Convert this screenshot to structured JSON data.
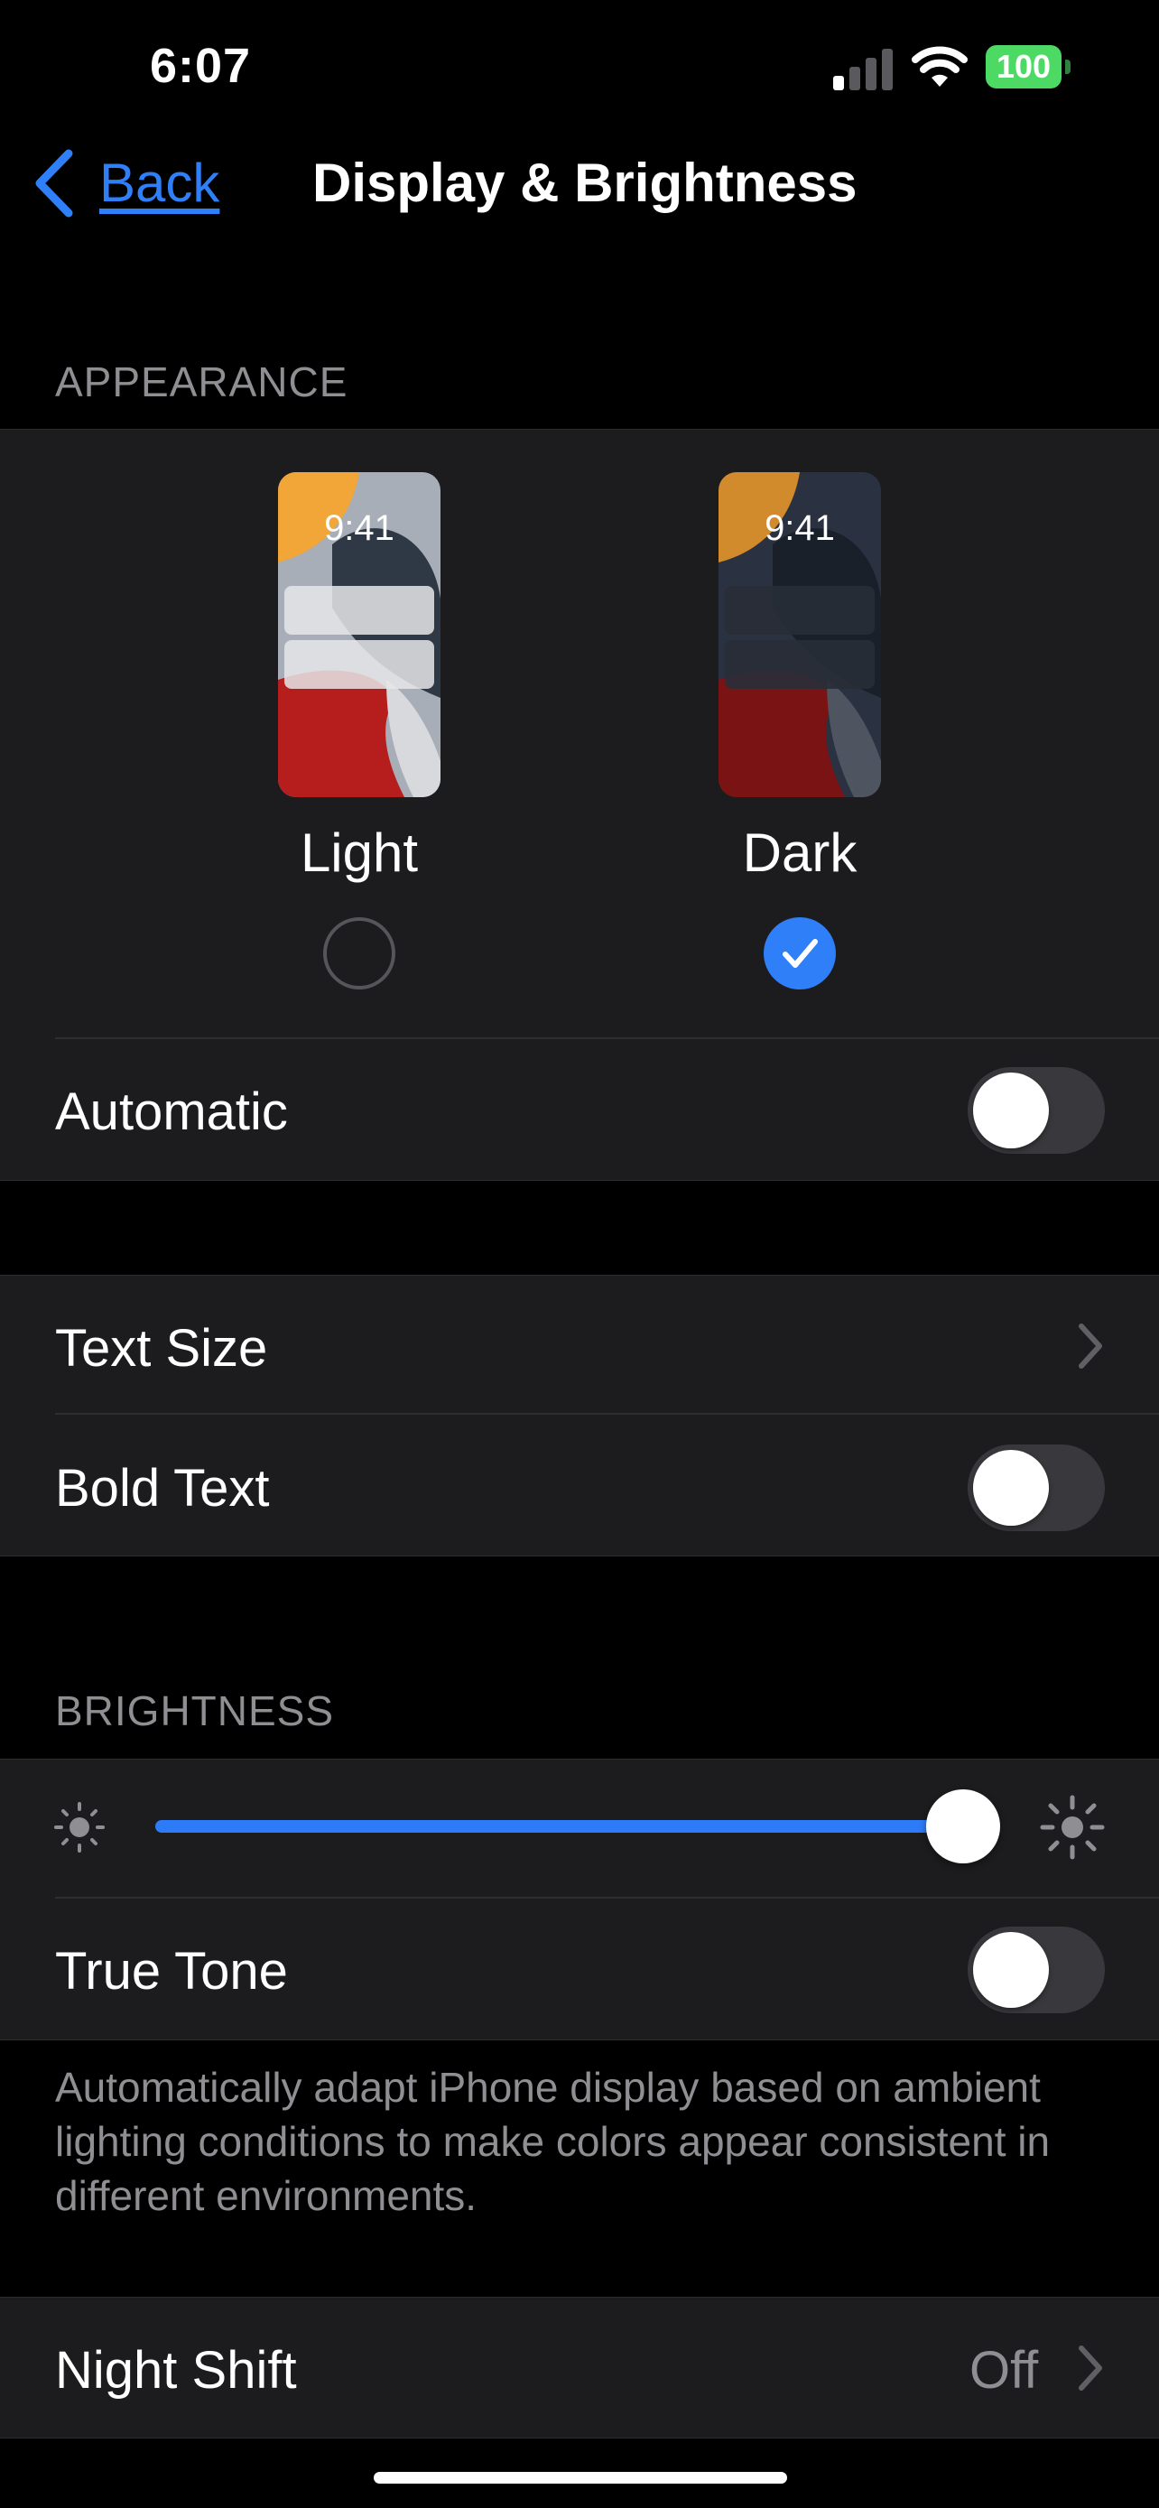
{
  "status_bar": {
    "time": "6:07",
    "battery": "100"
  },
  "nav": {
    "back_label": "Back",
    "title": "Display & Brightness"
  },
  "appearance": {
    "header": "APPEARANCE",
    "light": {
      "label": "Light",
      "preview_time": "9:41",
      "selected": false
    },
    "dark": {
      "label": "Dark",
      "preview_time": "9:41",
      "selected": true
    },
    "automatic": {
      "label": "Automatic",
      "on": false
    }
  },
  "text_group": {
    "text_size": {
      "label": "Text Size"
    },
    "bold_text": {
      "label": "Bold Text",
      "on": false
    }
  },
  "brightness": {
    "header": "BRIGHTNESS",
    "level": 0.98,
    "true_tone": {
      "label": "True Tone",
      "on": false
    },
    "footer": "Automatically adapt iPhone display based on ambient lighting conditions to make colors appear consistent in different environments."
  },
  "night_shift": {
    "label": "Night Shift",
    "value": "Off"
  },
  "colors": {
    "accent": "#2f7ff8",
    "toggle_off": "#39393d",
    "battery": "#4cd964",
    "group_bg": "#1c1c1e"
  }
}
